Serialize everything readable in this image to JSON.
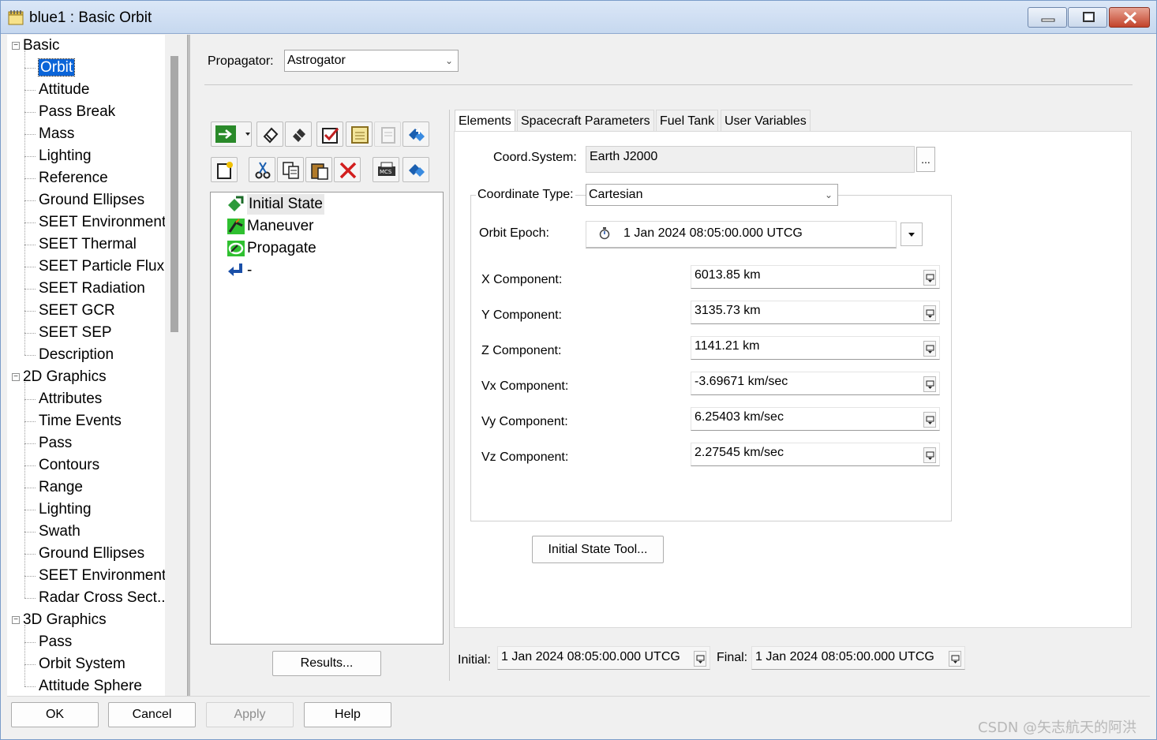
{
  "window": {
    "title": "blue1 : Basic Orbit"
  },
  "tree": {
    "groups": [
      {
        "label": "Basic",
        "items": [
          "Orbit",
          "Attitude",
          "Pass Break",
          "Mass",
          "Lighting",
          "Reference",
          "Ground Ellipses",
          "SEET Environment",
          "SEET Thermal",
          "SEET Particle Flux",
          "SEET Radiation",
          "SEET GCR",
          "SEET SEP",
          "Description"
        ]
      },
      {
        "label": "2D Graphics",
        "items": [
          "Attributes",
          "Time Events",
          "Pass",
          "Contours",
          "Range",
          "Lighting",
          "Swath",
          "Ground Ellipses",
          "SEET Environment",
          "Radar Cross Sect..."
        ]
      },
      {
        "label": "3D Graphics",
        "items": [
          "Pass",
          "Orbit System",
          "Attitude Sphere"
        ]
      }
    ],
    "selected": "Orbit",
    "expander_symbol": "−"
  },
  "propagator": {
    "label": "Propagator:",
    "value": "Astrogator"
  },
  "sequence": {
    "items": [
      {
        "label": "Initial State",
        "icon": "initial-state-icon"
      },
      {
        "label": "Maneuver",
        "icon": "maneuver-icon"
      },
      {
        "label": "Propagate",
        "icon": "propagate-icon"
      },
      {
        "label": "-",
        "icon": "return-icon"
      }
    ],
    "results_label": "Results..."
  },
  "tabs": [
    "Elements",
    "Spacecraft Parameters",
    "Fuel Tank",
    "User Variables"
  ],
  "elements": {
    "coord_system_label": "Coord.System:",
    "coord_system_value": "Earth J2000",
    "coord_system_button": "...",
    "coord_type_label": "Coordinate Type:",
    "coord_type_value": "Cartesian",
    "orbit_epoch_label": "Orbit Epoch:",
    "orbit_epoch_value": "1 Jan 2024 08:05:00.000 UTCG",
    "components": [
      {
        "label": "X Component:",
        "value": "6013.85 km"
      },
      {
        "label": "Y Component:",
        "value": "3135.73 km"
      },
      {
        "label": "Z Component:",
        "value": "1141.21 km"
      },
      {
        "label": "Vx Component:",
        "value": "-3.69671 km/sec"
      },
      {
        "label": "Vy Component:",
        "value": "6.25403 km/sec"
      },
      {
        "label": "Vz Component:",
        "value": "2.27545 km/sec"
      }
    ],
    "initial_state_tool": "Initial State Tool..."
  },
  "times": {
    "initial_label": "Initial:",
    "initial_value": "1 Jan 2024 08:05:00.000 UTCG",
    "final_label": "Final:",
    "final_value": "1 Jan 2024 08:05:00.000 UTCG"
  },
  "dialog_buttons": {
    "ok": "OK",
    "cancel": "Cancel",
    "apply": "Apply",
    "help": "Help"
  },
  "watermark": "CSDN @矢志航天的阿洪",
  "colors": {
    "selection": "#0a64d8",
    "title_gradient_top": "#dbe7f7",
    "close_button": "#c2432b"
  }
}
